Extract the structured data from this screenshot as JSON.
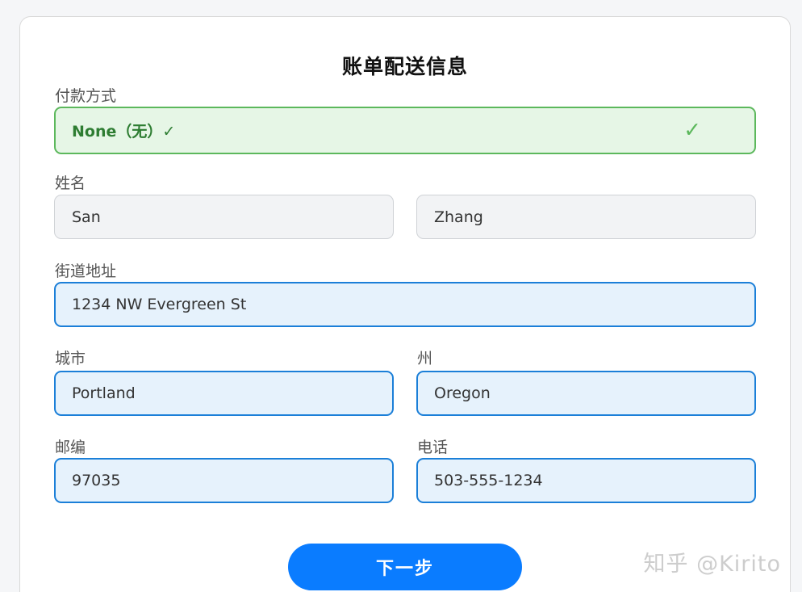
{
  "form": {
    "title": "账单配送信息",
    "payment": {
      "label": "付款方式",
      "value": "None（无）✓",
      "check_icon": "✓",
      "accent": "#5cb85c"
    },
    "name": {
      "label": "姓名",
      "first": "San",
      "last": "Zhang"
    },
    "street": {
      "label": "街道地址",
      "value": "1234 NW Evergreen St"
    },
    "city": {
      "label": "城市",
      "value": "Portland"
    },
    "state": {
      "label": "州",
      "value": "Oregon"
    },
    "zip": {
      "label": "邮编",
      "value": "97035"
    },
    "phone": {
      "label": "电话",
      "value": "503-555-1234"
    },
    "next_button": "下一步",
    "primary_color": "#0a7cff",
    "field_border_color": "#1b7fd8"
  },
  "watermark": "知乎 @Kirito"
}
